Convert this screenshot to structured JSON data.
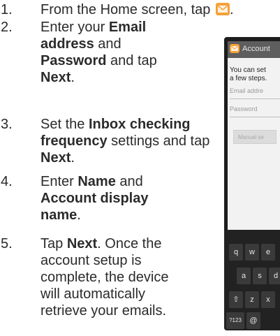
{
  "steps": [
    {
      "num": "1.",
      "pre": "From the Home screen, tap ",
      "icon": "email-app-icon",
      "post": "."
    },
    {
      "num": "2.",
      "t1": "Enter your ",
      "b1": "Email address",
      "t2": " and ",
      "b2": "Password",
      "t3": " and tap ",
      "b3": "Next",
      "t4": "."
    },
    {
      "num": "3.",
      "t1": "Set the ",
      "b1": "Inbox checking frequency",
      "t2": " settings and tap ",
      "b2": "Next",
      "t3": "."
    },
    {
      "num": "4.",
      "t1": "Enter ",
      "b1": "Name",
      "t2": " and ",
      "b2": "Account display name",
      "t3": "."
    },
    {
      "num": "5.",
      "t1": "Tap ",
      "b1": "Next",
      "t2": ". Once the account setup is complete, the device will automatically retrieve your emails."
    }
  ],
  "phone": {
    "title": "Account",
    "intro_line1": "You can set",
    "intro_line2": "a few steps.",
    "email_placeholder": "Email addre",
    "password_placeholder": "Password",
    "button": "Manual se",
    "keys_row1": [
      "q",
      "w",
      "e"
    ],
    "keys_row2": [
      "a",
      "s",
      "d"
    ],
    "keys_row3": [
      "⇧",
      "z",
      "x"
    ],
    "keys_row4": [
      "?123",
      "@"
    ]
  },
  "colors": {
    "text": "#2b2b2b",
    "accent": "#f4a23a",
    "phone_body": "#1d1d1d"
  }
}
